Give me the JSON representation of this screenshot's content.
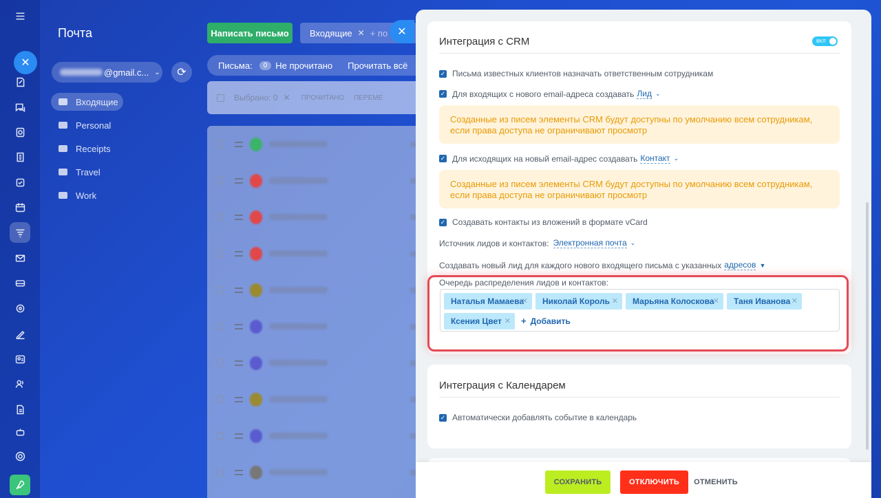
{
  "mail": {
    "title": "Почта",
    "account": "@gmail.c...",
    "compose_label": "Написать письмо",
    "filter_chip": "Входящие",
    "filter_plus": "+ по",
    "counter_label": "Письма:",
    "unread_count": "0",
    "unread_label": "Не прочитано",
    "read_all": "Прочитать всё",
    "selected": "Выбрано: 0",
    "action_read": "ПРОЧИТАНО",
    "action_move": "ПЕРЕМЕ",
    "folders": [
      {
        "label": "Входящие"
      },
      {
        "label": "Personal"
      },
      {
        "label": "Receipts"
      },
      {
        "label": "Travel"
      },
      {
        "label": "Work"
      }
    ],
    "avatar_colors": [
      "#3bb368",
      "#e0484a",
      "#e0484a",
      "#e0484a",
      "#9a8a30",
      "#5b5bd0",
      "#5b5bd0",
      "#9a8a30",
      "#5b5bd0",
      "#777777"
    ]
  },
  "crm": {
    "title": "Интеграция с CRM",
    "toggle_label": "ВКЛ",
    "opt_assign": "Письма известных клиентов назначать ответственным сотрудникам",
    "opt_incoming": "Для входящих с нового email-адреса создавать",
    "opt_incoming_value": "Лид",
    "notice_1": "Созданные из писем элементы CRM будут доступны по умолчанию всем сотрудникам, если права доступа не ограничивают просмотр",
    "opt_outgoing": "Для исходящих на новый email-адрес создавать",
    "opt_outgoing_value": "Контакт",
    "notice_2": "Созданные из писем элементы CRM будут доступны по умолчанию всем сотрудникам, если права доступа не ограничивают просмотр",
    "opt_vcard": "Создавать контакты из вложений в формате vCard",
    "source_label": "Источник лидов и контактов:",
    "source_value": "Электронная почта",
    "new_lead_label": "Создавать новый лид для каждого нового входящего письма с указанных",
    "new_lead_link": "адресов",
    "queue_label": "Очередь распределения лидов и контактов:",
    "queue": [
      {
        "name": "Наталья Мамаева"
      },
      {
        "name": "Николай Король"
      },
      {
        "name": "Марьяна Колоскова"
      },
      {
        "name": "Таня Иванова"
      },
      {
        "name": "Ксения Цвет"
      }
    ],
    "add_label": "Добавить"
  },
  "calendar": {
    "title": "Интеграция с Календарем",
    "opt_auto": "Автоматически добавлять событие в календарь"
  },
  "footer": {
    "save": "СОХРАНИТЬ",
    "disable": "ОТКЛЮЧИТЬ",
    "cancel": "ОТМЕНИТЬ"
  },
  "colors": {
    "accent": "#2067b0",
    "notice_text": "#e89b06",
    "notice_bg": "#fff3dc",
    "tag_bg": "#bce8fb",
    "save_btn": "#bbed21",
    "disable_btn": "#ff2f1a",
    "highlight": "#e14b55"
  }
}
